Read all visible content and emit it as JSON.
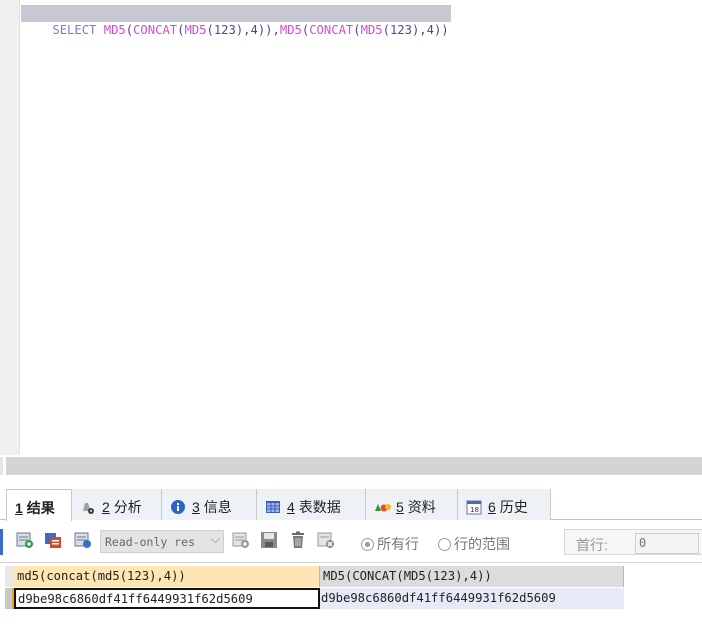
{
  "editor": {
    "sql_tokens": [
      {
        "text": "SELECT ",
        "kind": "kw"
      },
      {
        "text": "MD5",
        "kind": "fn"
      },
      {
        "text": "(",
        "kind": "pn"
      },
      {
        "text": "CONCAT",
        "kind": "fn"
      },
      {
        "text": "(",
        "kind": "pn"
      },
      {
        "text": "MD5",
        "kind": "fn"
      },
      {
        "text": "(123),4)),",
        "kind": "pn"
      },
      {
        "text": "MD5",
        "kind": "fn"
      },
      {
        "text": "(",
        "kind": "pn"
      },
      {
        "text": "CONCAT",
        "kind": "fn"
      },
      {
        "text": "(",
        "kind": "pn"
      },
      {
        "text": "MD5",
        "kind": "fn"
      },
      {
        "text": "(123),4))",
        "kind": "pn"
      }
    ]
  },
  "tabs": [
    {
      "num": "1",
      "label": "结果",
      "icon": "none",
      "active": true
    },
    {
      "num": "2",
      "label": "分析",
      "icon": "profile-icon",
      "active": false
    },
    {
      "num": "3",
      "label": "信息",
      "icon": "info-icon",
      "active": false
    },
    {
      "num": "4",
      "label": "表数据",
      "icon": "table-icon",
      "active": false
    },
    {
      "num": "5",
      "label": "资料",
      "icon": "shapes-icon",
      "active": false
    },
    {
      "num": "6",
      "label": "历史",
      "icon": "calendar-icon",
      "active": false
    }
  ],
  "toolbar": {
    "mode_select": "Read-only res",
    "radio_all_rows": "所有行",
    "radio_row_range": "行的范围",
    "first_row_label": "首行:",
    "first_row_value": "0"
  },
  "grid": {
    "columns": [
      "md5(concat(md5(123),4))",
      "MD5(CONCAT(MD5(123),4))"
    ],
    "rows": [
      [
        "d9be98c6860df41ff6449931f62d5609",
        "d9be98c6860df41ff6449931f62d5609"
      ]
    ]
  },
  "colors": {
    "keyword": "#7a7ad8",
    "function": "#d24cd2",
    "active_column_header": "#fde6b4"
  }
}
